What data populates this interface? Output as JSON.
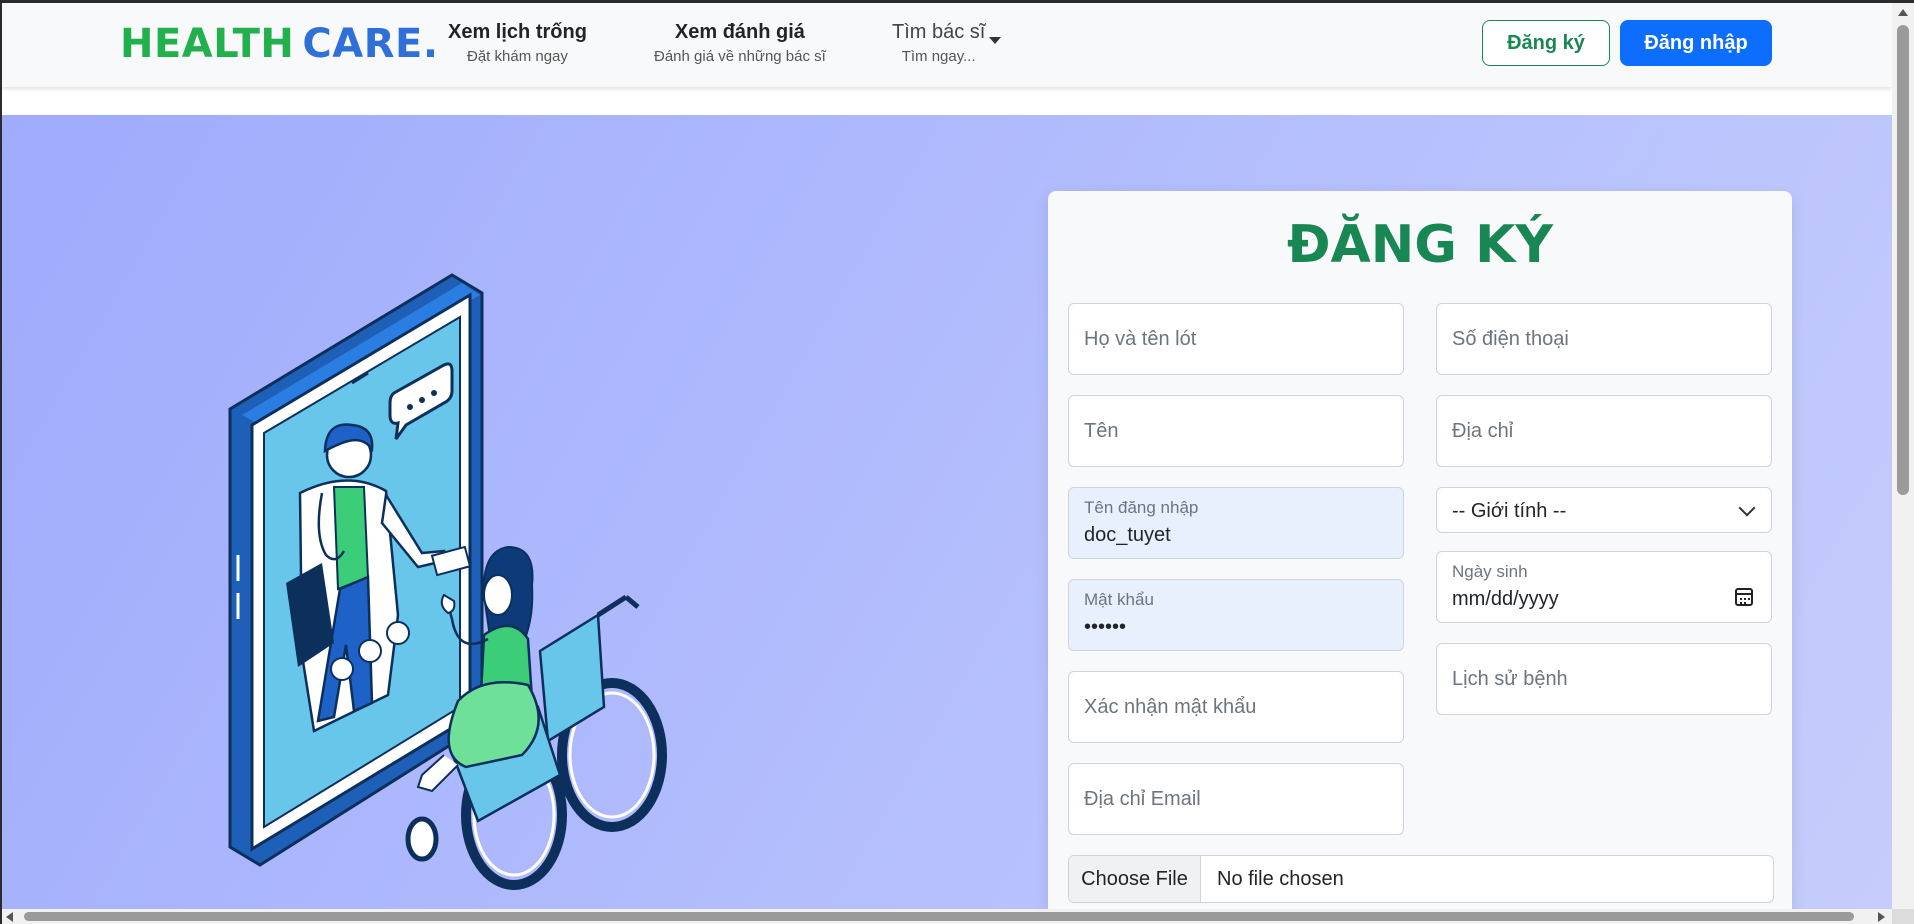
{
  "brand": {
    "part1": "HEALTH",
    "part2": "CARE."
  },
  "nav": [
    {
      "title": "Xem lịch trống",
      "subtitle": "Đặt khám ngay"
    },
    {
      "title": "Xem đánh giá",
      "subtitle": "Đánh giá về những bác sĩ"
    },
    {
      "title": "Tìm bác sĩ",
      "subtitle": "Tìm ngay..."
    }
  ],
  "header_buttons": {
    "register": "Đăng ký",
    "login": "Đăng nhập"
  },
  "form": {
    "title": "ĐĂNG KÝ",
    "left": {
      "last_middle_name": "Họ và tên lót",
      "first_name": "Tên",
      "username_label": "Tên đăng nhập",
      "username_value": "doc_tuyet",
      "password_label": "Mật khẩu",
      "password_value": "••••••",
      "confirm_password": "Xác nhận mật khẩu",
      "email": "Địa chỉ Email"
    },
    "right": {
      "phone": "Số điện thoại",
      "address": "Địa chỉ",
      "gender_selected": "-- Giới tính --",
      "dob_label": "Ngày sinh",
      "dob_value": "mm/dd/yyyy",
      "medical_history": "Lịch sử bệnh"
    },
    "file": {
      "button": "Choose File",
      "status": "No file chosen"
    }
  },
  "colors": {
    "brand_green": "#21b04b",
    "brand_blue": "#2f6fd8",
    "primary": "#0d6efd",
    "success": "#198754"
  }
}
